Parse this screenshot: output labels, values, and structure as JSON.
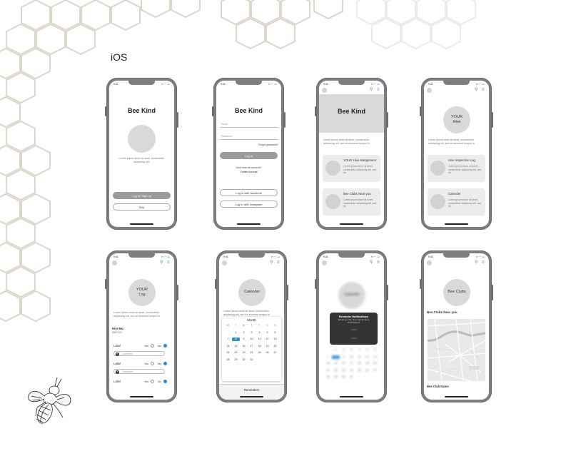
{
  "platform_label": "iOS",
  "status_time": "9:41",
  "app_name": "Bee Kind",
  "lorem_short": "Lorem ipsum dolor sit amet, consectetur adipiscing elit,",
  "lorem_long": "Lorem ipsum dolor sit amet, consectetur adipiscing elit, sed do eiusmod tempor in",
  "lorem_card": "Lorem ipsum dolor sit amet, consectetur adipiscing elit, sed do",
  "screen1": {
    "login_signup": "Log In/ Sign up",
    "skip": "Skip"
  },
  "screen2": {
    "email_placeholder": "Email",
    "password_placeholder": "Password",
    "forgot": "Forgot password?",
    "login": "Log in",
    "no_account": "Dont have an account?",
    "create": "Create Account",
    "facebook": "Log in with facebook",
    "instagram": "Log in with Instagram"
  },
  "screen3": {
    "card1": "YOUR Hive Mangement",
    "card2": "Bee Clubs Near you"
  },
  "screen4": {
    "hero_line1": "YOUR",
    "hero_line2": "Hive",
    "card1": "Hive Inspection Log",
    "card2": "Calender"
  },
  "screen5": {
    "hero_line1": "YOUR",
    "hero_line2": "Log",
    "hive_no": "Hive No.",
    "hive_date": "08/07/21",
    "label": "Label",
    "yes": "Yes",
    "no": "No",
    "comment": "Comment"
  },
  "screen6": {
    "hero": "Calender",
    "month": "Month",
    "weekdays": [
      "M",
      "T",
      "W",
      "T",
      "F",
      "S",
      "S"
    ],
    "days": [
      "",
      "1",
      "2",
      "3",
      "4",
      "5",
      "6",
      "7",
      "8",
      "9",
      "10",
      "11",
      "12",
      "13",
      "14",
      "15",
      "16",
      "17",
      "18",
      "19",
      "20",
      "21",
      "22",
      "23",
      "24",
      "25",
      "26",
      "27",
      "28",
      "29",
      "30",
      "31",
      "",
      "",
      ""
    ],
    "selected_day": "8",
    "reminders": "Reminders"
  },
  "screen7": {
    "hero": "Calender",
    "alert_title": "Reminder Notifications",
    "alert_msg": "Would you like hive maintenance notifications?",
    "alert_btn1": "Label",
    "alert_btn2": "Label"
  },
  "screen8": {
    "hero": "Bee Clubs",
    "near": "Bee Clubs Near you",
    "club_name": "Bee Club Name"
  },
  "colors": {
    "accent": "#2b8cd6",
    "placeholder": "#d9d9d9",
    "frame": "#7e7e82"
  }
}
